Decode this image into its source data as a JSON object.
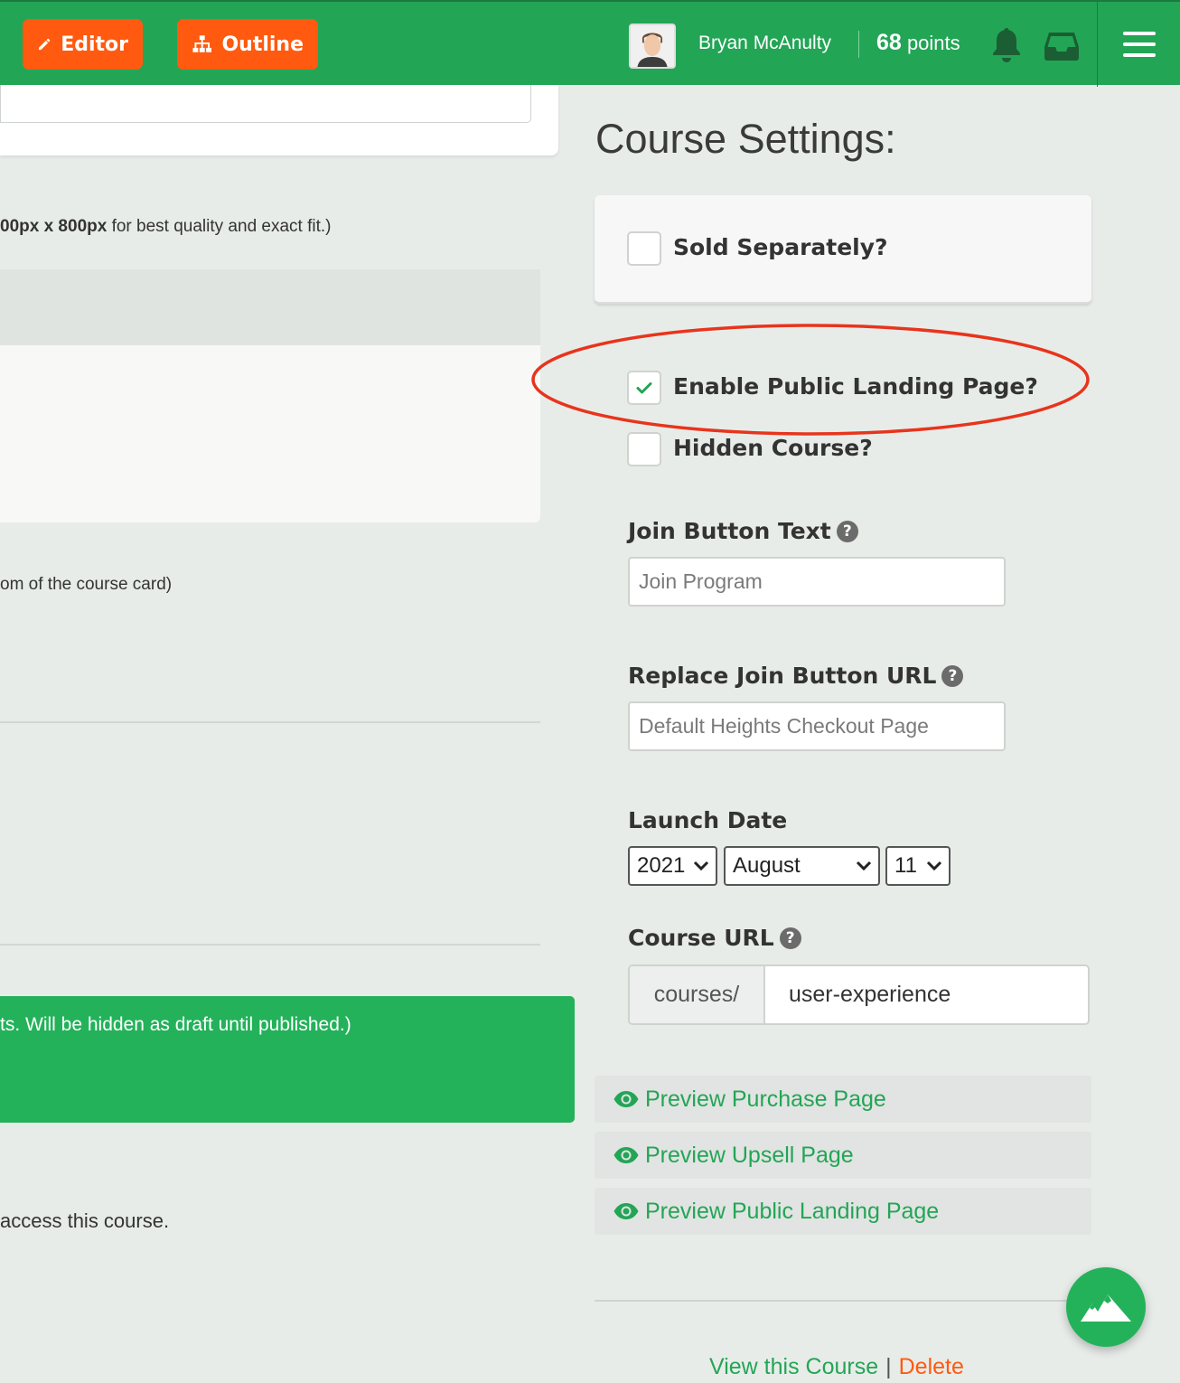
{
  "toolbar": {
    "editor_label": "Editor",
    "outline_label": "Outline"
  },
  "user": {
    "name": "Bryan McAnulty",
    "points_value": "68",
    "points_unit": "points"
  },
  "left_pane": {
    "image_hint_bold": "00px x 800px",
    "image_hint_rest": " for best quality and exact fit.)",
    "card_hint": "om of the course card)",
    "draft_note": "ts. Will be hidden as draft until published.)",
    "access_note": "access this course."
  },
  "settings": {
    "title": "Course Settings:",
    "sold_separately": {
      "label": "Sold Separately?",
      "checked": false
    },
    "public_landing": {
      "label": "Enable Public Landing Page?",
      "checked": true
    },
    "hidden_course": {
      "label": "Hidden Course?",
      "checked": false
    },
    "join_button_text": {
      "label": "Join Button Text",
      "placeholder": "Join Program",
      "value": ""
    },
    "replace_join_url": {
      "label": "Replace Join Button URL",
      "placeholder": "Default Heights Checkout Page",
      "value": ""
    },
    "launch_date": {
      "label": "Launch Date",
      "year": "2021",
      "month": "August",
      "day": "11"
    },
    "course_url": {
      "label": "Course URL",
      "prefix": "courses/",
      "value": "user-experience"
    },
    "help_glyph": "?"
  },
  "previews": [
    {
      "label": "Preview Purchase Page"
    },
    {
      "label": "Preview Upsell Page"
    },
    {
      "label": "Preview Public Landing Page"
    }
  ],
  "footer": {
    "view_label": "View this Course",
    "separator": "|",
    "delete_label": "Delete"
  },
  "colors": {
    "brand_green": "#23a556",
    "accent_orange": "#ff5a0f",
    "annotation_red": "#e8341c"
  },
  "icons": {
    "editor": "pencil-icon",
    "outline": "sitemap-icon",
    "notifications": "bell-icon",
    "inbox": "inbox-icon",
    "menu": "hamburger-icon",
    "preview": "eye-icon",
    "fab": "mountains-icon"
  }
}
